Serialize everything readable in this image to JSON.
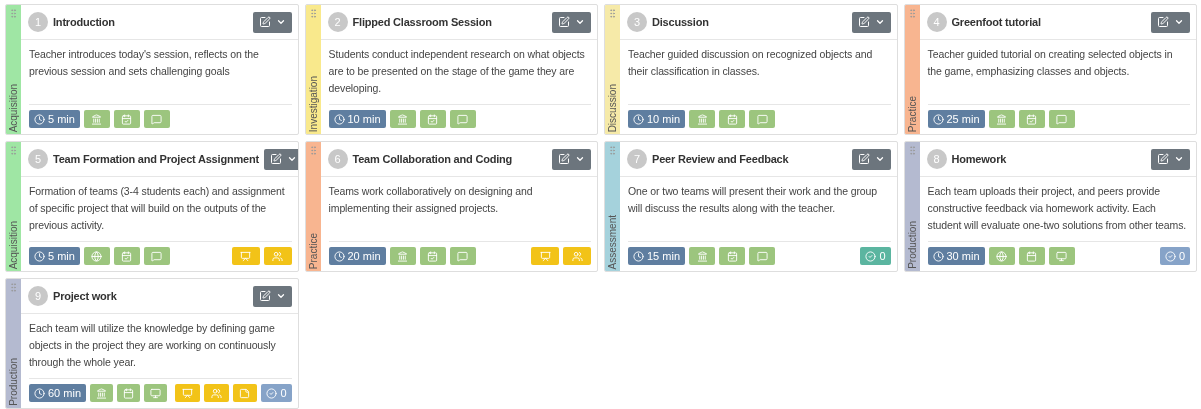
{
  "cards": [
    {
      "number": "1",
      "title": "Introduction",
      "description": "Teacher introduces today's session, reflects on the previous session and sets challenging goals",
      "phase": {
        "label": "Acquisition",
        "color": "#9fe6a4"
      },
      "duration": "5 min",
      "tools": [
        {
          "kind": "institution"
        },
        {
          "kind": "calendar-check"
        },
        {
          "kind": "chat"
        }
      ]
    },
    {
      "number": "2",
      "title": "Flipped Classroom Session",
      "description": "Students conduct independent research on what objects are to be presented on the stage of the game they are developing.",
      "phase": {
        "label": "Investigation",
        "color": "#f9e98c"
      },
      "duration": "10 min",
      "tools": [
        {
          "kind": "institution"
        },
        {
          "kind": "calendar-check"
        },
        {
          "kind": "chat"
        }
      ]
    },
    {
      "number": "3",
      "title": "Discussion",
      "description": "Teacher guided discussion on recognized objects and their classification in classes.",
      "phase": {
        "label": "Discussion",
        "color": "#f6eaa8"
      },
      "duration": "10 min",
      "tools": [
        {
          "kind": "institution"
        },
        {
          "kind": "calendar-check"
        },
        {
          "kind": "chat"
        }
      ]
    },
    {
      "number": "4",
      "title": "Greenfoot tutorial",
      "description": "Teacher guided tutorial on creating selected objects in the game, emphasizing classes and objects.",
      "phase": {
        "label": "Practice",
        "color": "#f8b590"
      },
      "duration": "25 min",
      "tools": [
        {
          "kind": "institution"
        },
        {
          "kind": "calendar-check"
        },
        {
          "kind": "chat"
        }
      ]
    },
    {
      "number": "5",
      "title": "Team Formation and Project Assignment",
      "description": "Formation of teams (3-4 students each) and assignment of specific project that will build on the outputs of the previous activity.",
      "phase": {
        "label": "Acquisition",
        "color": "#9fe6a4"
      },
      "duration": "5 min",
      "tools": [
        {
          "kind": "globe"
        },
        {
          "kind": "calendar-check"
        },
        {
          "kind": "chat"
        }
      ],
      "extras": [
        {
          "kind": "group"
        },
        {
          "kind": "team"
        }
      ]
    },
    {
      "number": "6",
      "title": "Team Collaboration and Coding",
      "description": "Teams work collaboratively on designing and implementing their assigned projects.",
      "phase": {
        "label": "Practice",
        "color": "#f8b590"
      },
      "duration": "20 min",
      "tools": [
        {
          "kind": "institution"
        },
        {
          "kind": "calendar-check"
        },
        {
          "kind": "chat"
        }
      ],
      "extras": [
        {
          "kind": "group"
        },
        {
          "kind": "team"
        }
      ]
    },
    {
      "number": "7",
      "title": "Peer Review and Feedback",
      "description": "One or two teams will present their work and the group will discuss the results along with the teacher.",
      "phase": {
        "label": "Assessment",
        "color": "#a5d2dc"
      },
      "duration": "15 min",
      "tools": [
        {
          "kind": "institution"
        },
        {
          "kind": "calendar-check"
        },
        {
          "kind": "chat"
        }
      ],
      "check": {
        "count": "0",
        "color": "#5bb5a0"
      }
    },
    {
      "number": "8",
      "title": "Homework",
      "description": "Each team uploads their project, and peers provide constructive feedback via homework activity. Each student will evaluate one-two solutions from other teams.",
      "phase": {
        "label": "Production",
        "color": "#b4bad0"
      },
      "duration": "30 min",
      "tools": [
        {
          "kind": "globe"
        },
        {
          "kind": "calendar"
        },
        {
          "kind": "screen"
        }
      ],
      "check": {
        "count": "0",
        "color": "#86a3c8"
      }
    },
    {
      "number": "9",
      "title": "Project work",
      "description": "Each team will utilize the knowledge by defining game objects in the project they are working on continuously through the whole year.",
      "phase": {
        "label": "Production",
        "color": "#b4bad0"
      },
      "duration": "60 min",
      "tools": [
        {
          "kind": "institution"
        },
        {
          "kind": "calendar"
        },
        {
          "kind": "screen"
        }
      ],
      "extras": [
        {
          "kind": "group"
        },
        {
          "kind": "team"
        },
        {
          "kind": "note"
        }
      ],
      "check": {
        "count": "0",
        "color": "#86a3c8"
      }
    }
  ]
}
